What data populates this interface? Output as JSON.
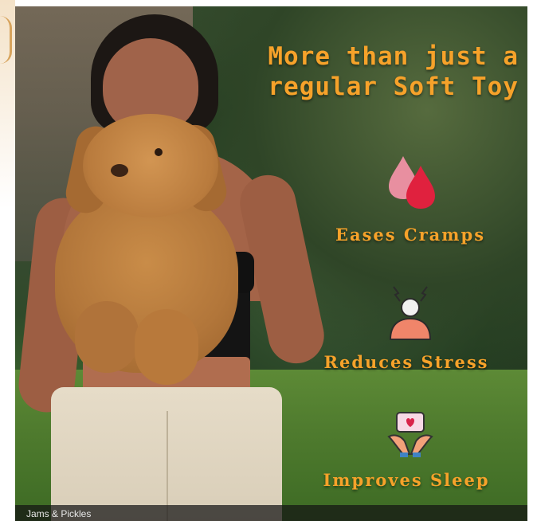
{
  "headline": {
    "line1": "More than just a",
    "line2": "regular Soft Toy"
  },
  "features": [
    {
      "icon": "water-drops-icon",
      "label": "Eases Cramps"
    },
    {
      "icon": "stressed-person-icon",
      "label": "Reduces Stress"
    },
    {
      "icon": "pillow-heart-icon",
      "label": "Improves Sleep"
    }
  ],
  "caption": "Jams & Pickles",
  "colors": {
    "accent": "#f6a22a",
    "drop_pink": "#e88fa0",
    "drop_red": "#e0213e"
  }
}
